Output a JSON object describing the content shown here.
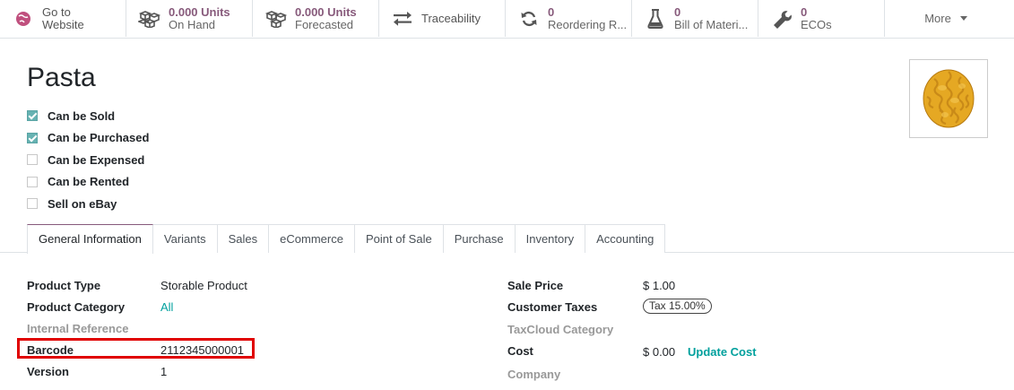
{
  "smart_buttons": [
    {
      "id": "website",
      "line1": "Go to",
      "line2": "Website",
      "icon": "globe-icon"
    },
    {
      "id": "on_hand",
      "value": "0.000 Units",
      "label": "On Hand",
      "icon": "cubes-icon"
    },
    {
      "id": "forecasted",
      "value": "0.000 Units",
      "label": "Forecasted",
      "icon": "cubes-icon"
    },
    {
      "id": "traceability",
      "label": "Traceability",
      "icon": "exchange-icon"
    },
    {
      "id": "reordering",
      "value": "0",
      "label": "Reordering R...",
      "icon": "refresh-icon"
    },
    {
      "id": "bom",
      "value": "0",
      "label": "Bill of Materi...",
      "icon": "flask-icon"
    },
    {
      "id": "ecos",
      "value": "0",
      "label": "ECOs",
      "icon": "wrench-icon"
    }
  ],
  "more_label": "More",
  "product": {
    "name": "Pasta",
    "image_icon": "pasta-image"
  },
  "checkboxes": [
    {
      "label": "Can be Sold",
      "checked": true
    },
    {
      "label": "Can be Purchased",
      "checked": true
    },
    {
      "label": "Can be Expensed",
      "checked": false
    },
    {
      "label": "Can be Rented",
      "checked": false
    },
    {
      "label": "Sell on eBay",
      "checked": false
    }
  ],
  "tabs": [
    "General Information",
    "Variants",
    "Sales",
    "eCommerce",
    "Point of Sale",
    "Purchase",
    "Inventory",
    "Accounting"
  ],
  "left_fields": {
    "product_type": {
      "label": "Product Type",
      "value": "Storable Product"
    },
    "product_category": {
      "label": "Product Category",
      "value": "All"
    },
    "internal_reference": {
      "label": "Internal Reference",
      "value": ""
    },
    "barcode": {
      "label": "Barcode",
      "value": "2112345000001"
    },
    "version": {
      "label": "Version",
      "value": "1"
    }
  },
  "right_fields": {
    "sale_price": {
      "label": "Sale Price",
      "value": "$ 1.00"
    },
    "customer_taxes": {
      "label": "Customer Taxes",
      "value": "Tax 15.00%"
    },
    "taxcloud_category": {
      "label": "TaxCloud Category",
      "value": ""
    },
    "cost": {
      "label": "Cost",
      "value": "$ 0.00",
      "action": "Update Cost"
    },
    "company": {
      "label": "Company",
      "value": ""
    }
  },
  "colors": {
    "accent": "#875a7b",
    "link": "#00a09d",
    "highlight": "#e00000",
    "checkbox": "#66b2b2"
  }
}
